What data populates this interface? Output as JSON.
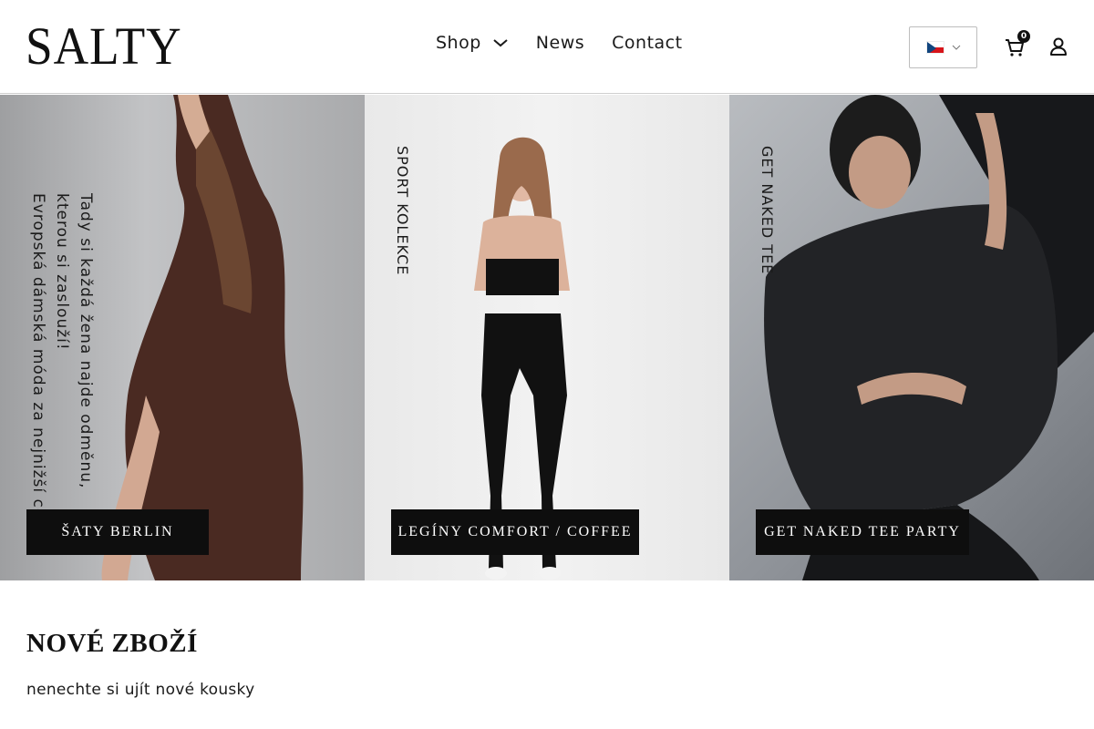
{
  "header": {
    "logo": "SALTY",
    "nav": {
      "shop": "Shop",
      "news": "News",
      "contact": "Contact"
    },
    "language_flag": "czech-flag-icon",
    "cart_count": "0",
    "icons": {
      "cart": "cart-icon",
      "account": "user-icon",
      "dropdown": "chevron-down-icon"
    }
  },
  "hero": {
    "panels": [
      {
        "vertical_lines": [
          "Tady si každá žena najde odměnu,",
          "kterou si zaslouží!",
          "Evropská dámská móda za nejnižší ceny."
        ],
        "cta": "ŠATY BERLIN"
      },
      {
        "vertical_lines": [
          "SPORT KOLEKCE"
        ],
        "cta": "LEGÍNY COMFORT / COFFEE"
      },
      {
        "vertical_lines": [
          "GET NAKED TEE"
        ],
        "cta": "GET NAKED TEE PARTY"
      }
    ]
  },
  "new_products": {
    "title": "NOVÉ ZBOŽÍ",
    "subtitle": "nenechte si ujít nové kousky"
  },
  "colors": {
    "cta_background": "#0e0e0e",
    "accent": "#111111",
    "flag_blue": "#11457e",
    "flag_red": "#d7141a"
  }
}
